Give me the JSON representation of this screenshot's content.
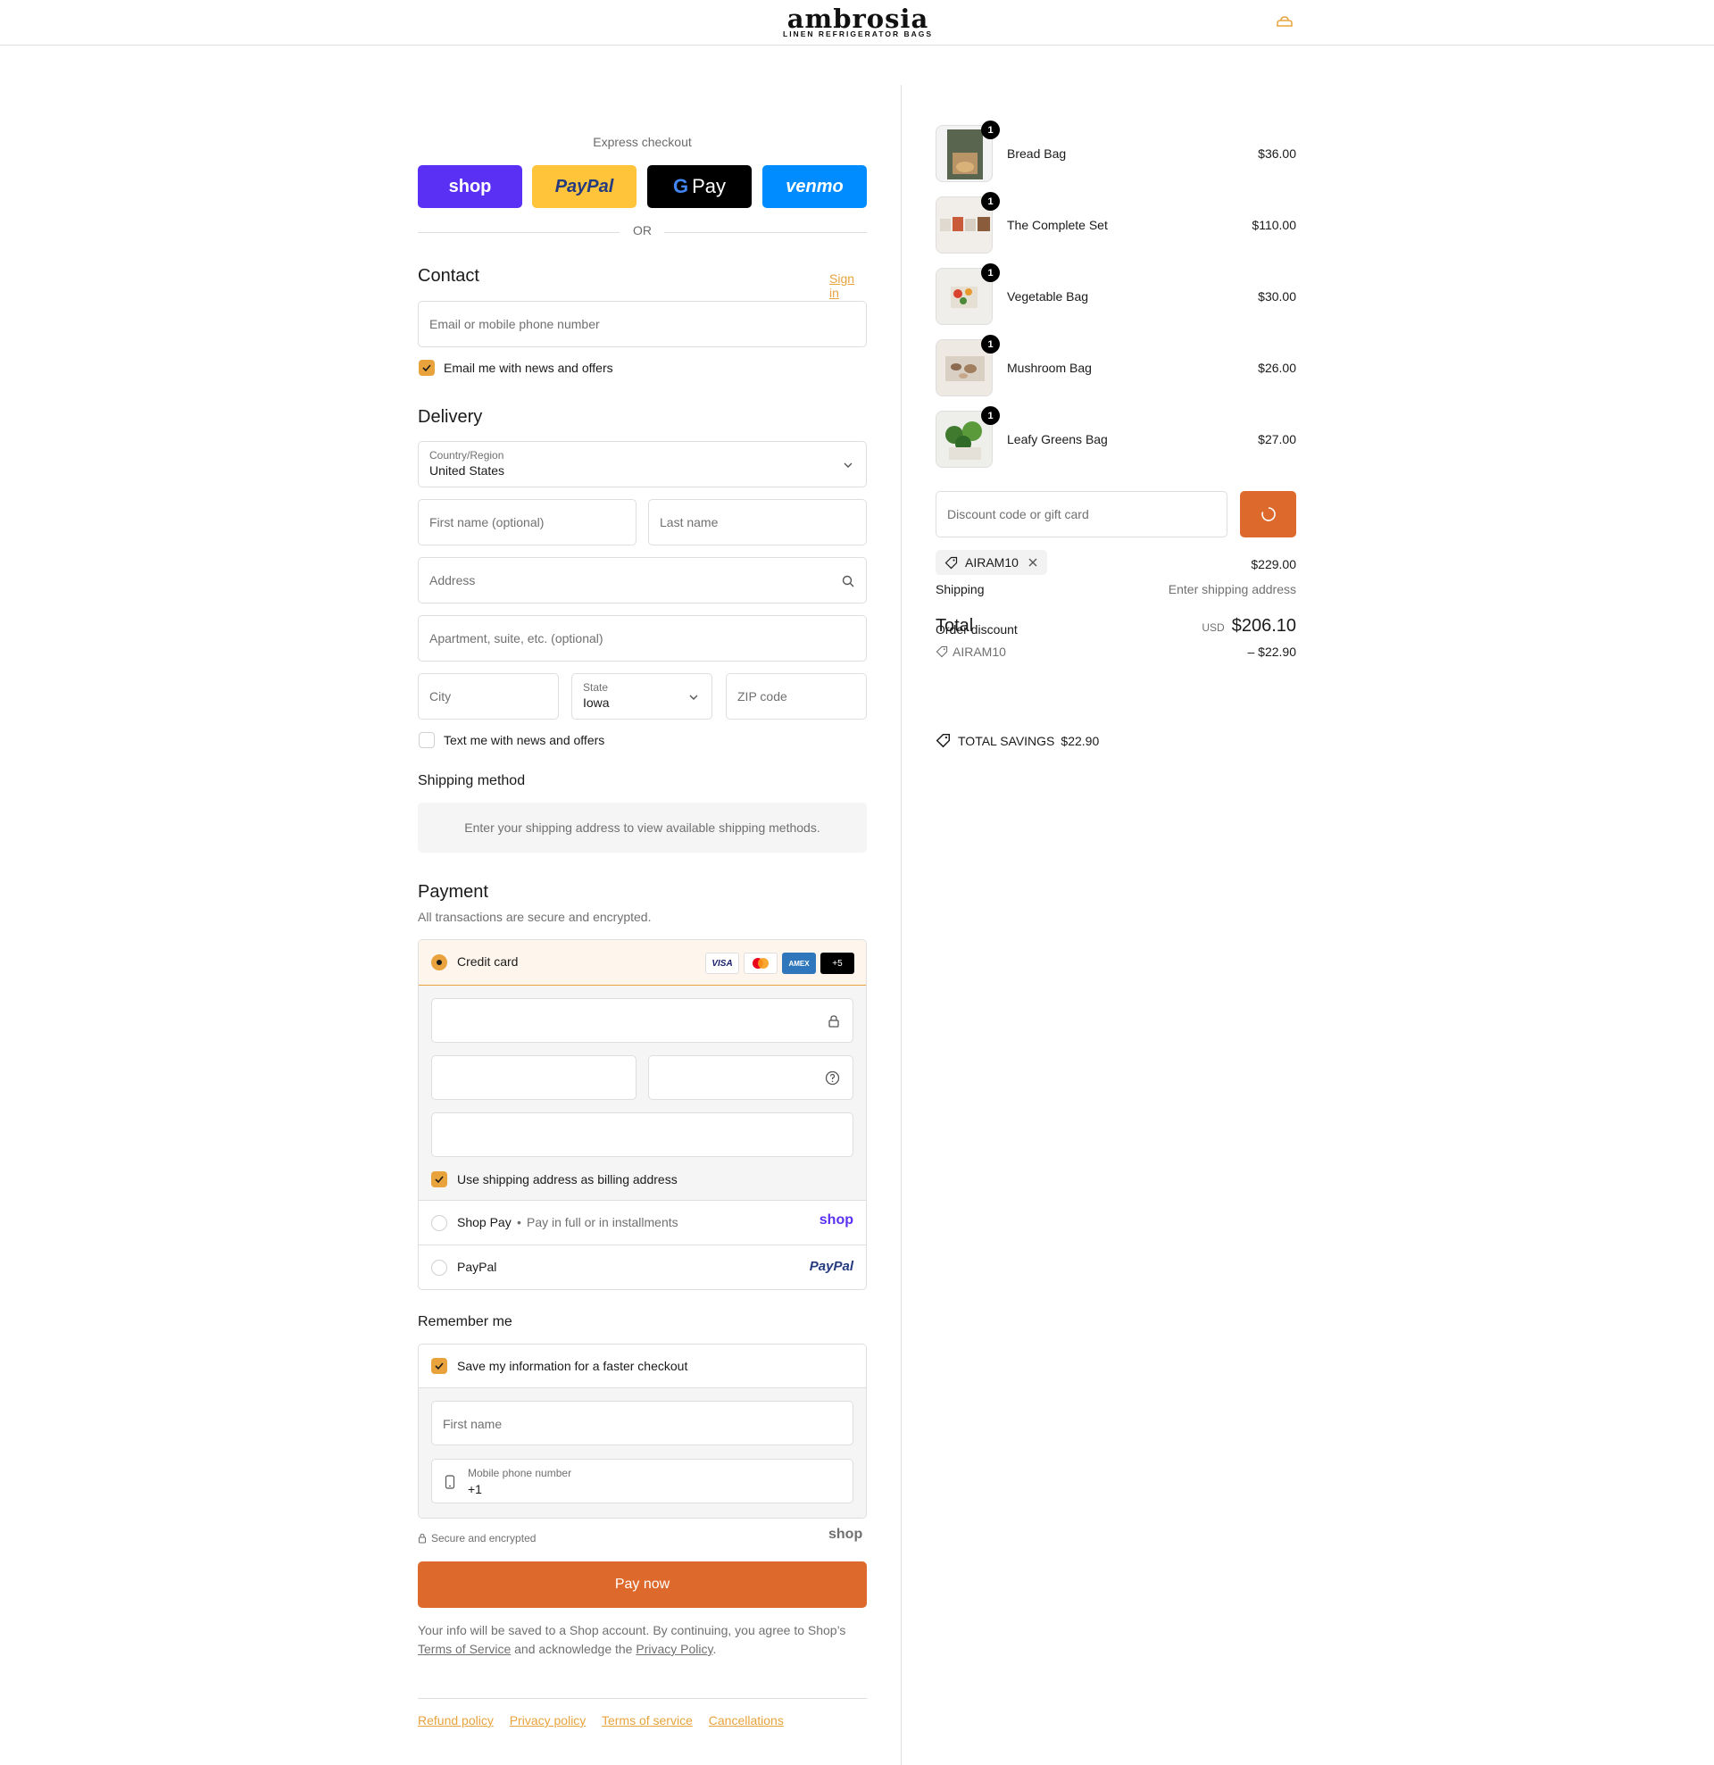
{
  "header": {
    "brand_name": "ambrosia",
    "brand_tagline": "LINEN REFRIGERATOR BAGS"
  },
  "express": {
    "title": "Express checkout",
    "buttons": [
      {
        "label": "shop",
        "color": "#5a31f4"
      },
      {
        "label": "PayPal",
        "color": "#ffc439"
      },
      {
        "label": "Pay",
        "prefix": "G",
        "color": "#000000"
      },
      {
        "label": "venmo",
        "color": "#008cff"
      }
    ],
    "or_text": "OR"
  },
  "contact": {
    "title": "Contact",
    "signin_label": "Sign in",
    "email_placeholder": "Email or mobile phone number",
    "newsletter_label": "Email me with news and offers",
    "newsletter_checked": true
  },
  "delivery": {
    "title": "Delivery",
    "country_label": "Country/Region",
    "country_value": "United States",
    "first_name_placeholder": "First name (optional)",
    "last_name_placeholder": "Last name",
    "address_placeholder": "Address",
    "apartment_placeholder": "Apartment, suite, etc. (optional)",
    "city_placeholder": "City",
    "state_label": "State",
    "state_value": "Iowa",
    "zip_placeholder": "ZIP code",
    "text_offers_label": "Text me with news and offers",
    "text_offers_checked": false
  },
  "shipping_method": {
    "title": "Shipping method",
    "message": "Enter your shipping address to view available shipping methods."
  },
  "payment": {
    "title": "Payment",
    "subtitle": "All transactions are secure and encrypted.",
    "credit_card_label": "Credit card",
    "card_logos": [
      "VISA",
      "MC",
      "AMEX",
      "+5"
    ],
    "billing_same_label": "Use shipping address as billing address",
    "shop_pay_label": "Shop Pay",
    "shop_pay_sub": "Pay in full or in installments",
    "shop_pay_logo": "shop",
    "paypal_label": "PayPal",
    "paypal_logo": "PayPal"
  },
  "remember": {
    "title": "Remember me",
    "save_label": "Save my information for a faster checkout",
    "first_name_placeholder": "First name",
    "phone_label": "Mobile phone number",
    "phone_value": "+1",
    "secure_label": "Secure and encrypted",
    "shop_logo": "shop"
  },
  "pay_now_label": "Pay now",
  "legal": {
    "line1": "Your info will be saved to a Shop account. By continuing, you agree to Shop’s",
    "terms": "Terms of Service",
    "mid": "and acknowledge the",
    "privacy": "Privacy Policy",
    "end": "."
  },
  "footer_links": [
    "Refund policy",
    "Privacy policy",
    "Terms of service",
    "Cancellations"
  ],
  "summary": {
    "items": [
      {
        "name": "Bread Bag",
        "price": "$36.00",
        "qty": "1"
      },
      {
        "name": "The Complete Set",
        "price": "$110.00",
        "qty": "1"
      },
      {
        "name": "Vegetable Bag",
        "price": "$30.00",
        "qty": "1"
      },
      {
        "name": "Mushroom Bag",
        "price": "$26.00",
        "qty": "1"
      },
      {
        "name": "Leafy Greens Bag",
        "price": "$27.00",
        "qty": "1"
      }
    ],
    "discount_placeholder": "Discount code or gift card",
    "applied_code": "AIRAM10",
    "subtotal_value": "$229.00",
    "shipping_label": "Shipping",
    "shipping_value": "Enter shipping address",
    "total_label": "Total",
    "order_discount_label": "Order discount",
    "currency": "USD",
    "total_value": "$206.10",
    "discount_code": "AIRAM10",
    "discount_value": "– $22.90",
    "savings_label": "TOTAL SAVINGS",
    "savings_value": "$22.90"
  },
  "colors": {
    "accent": "#e8a33c",
    "pay_button": "#dd6a2c"
  }
}
